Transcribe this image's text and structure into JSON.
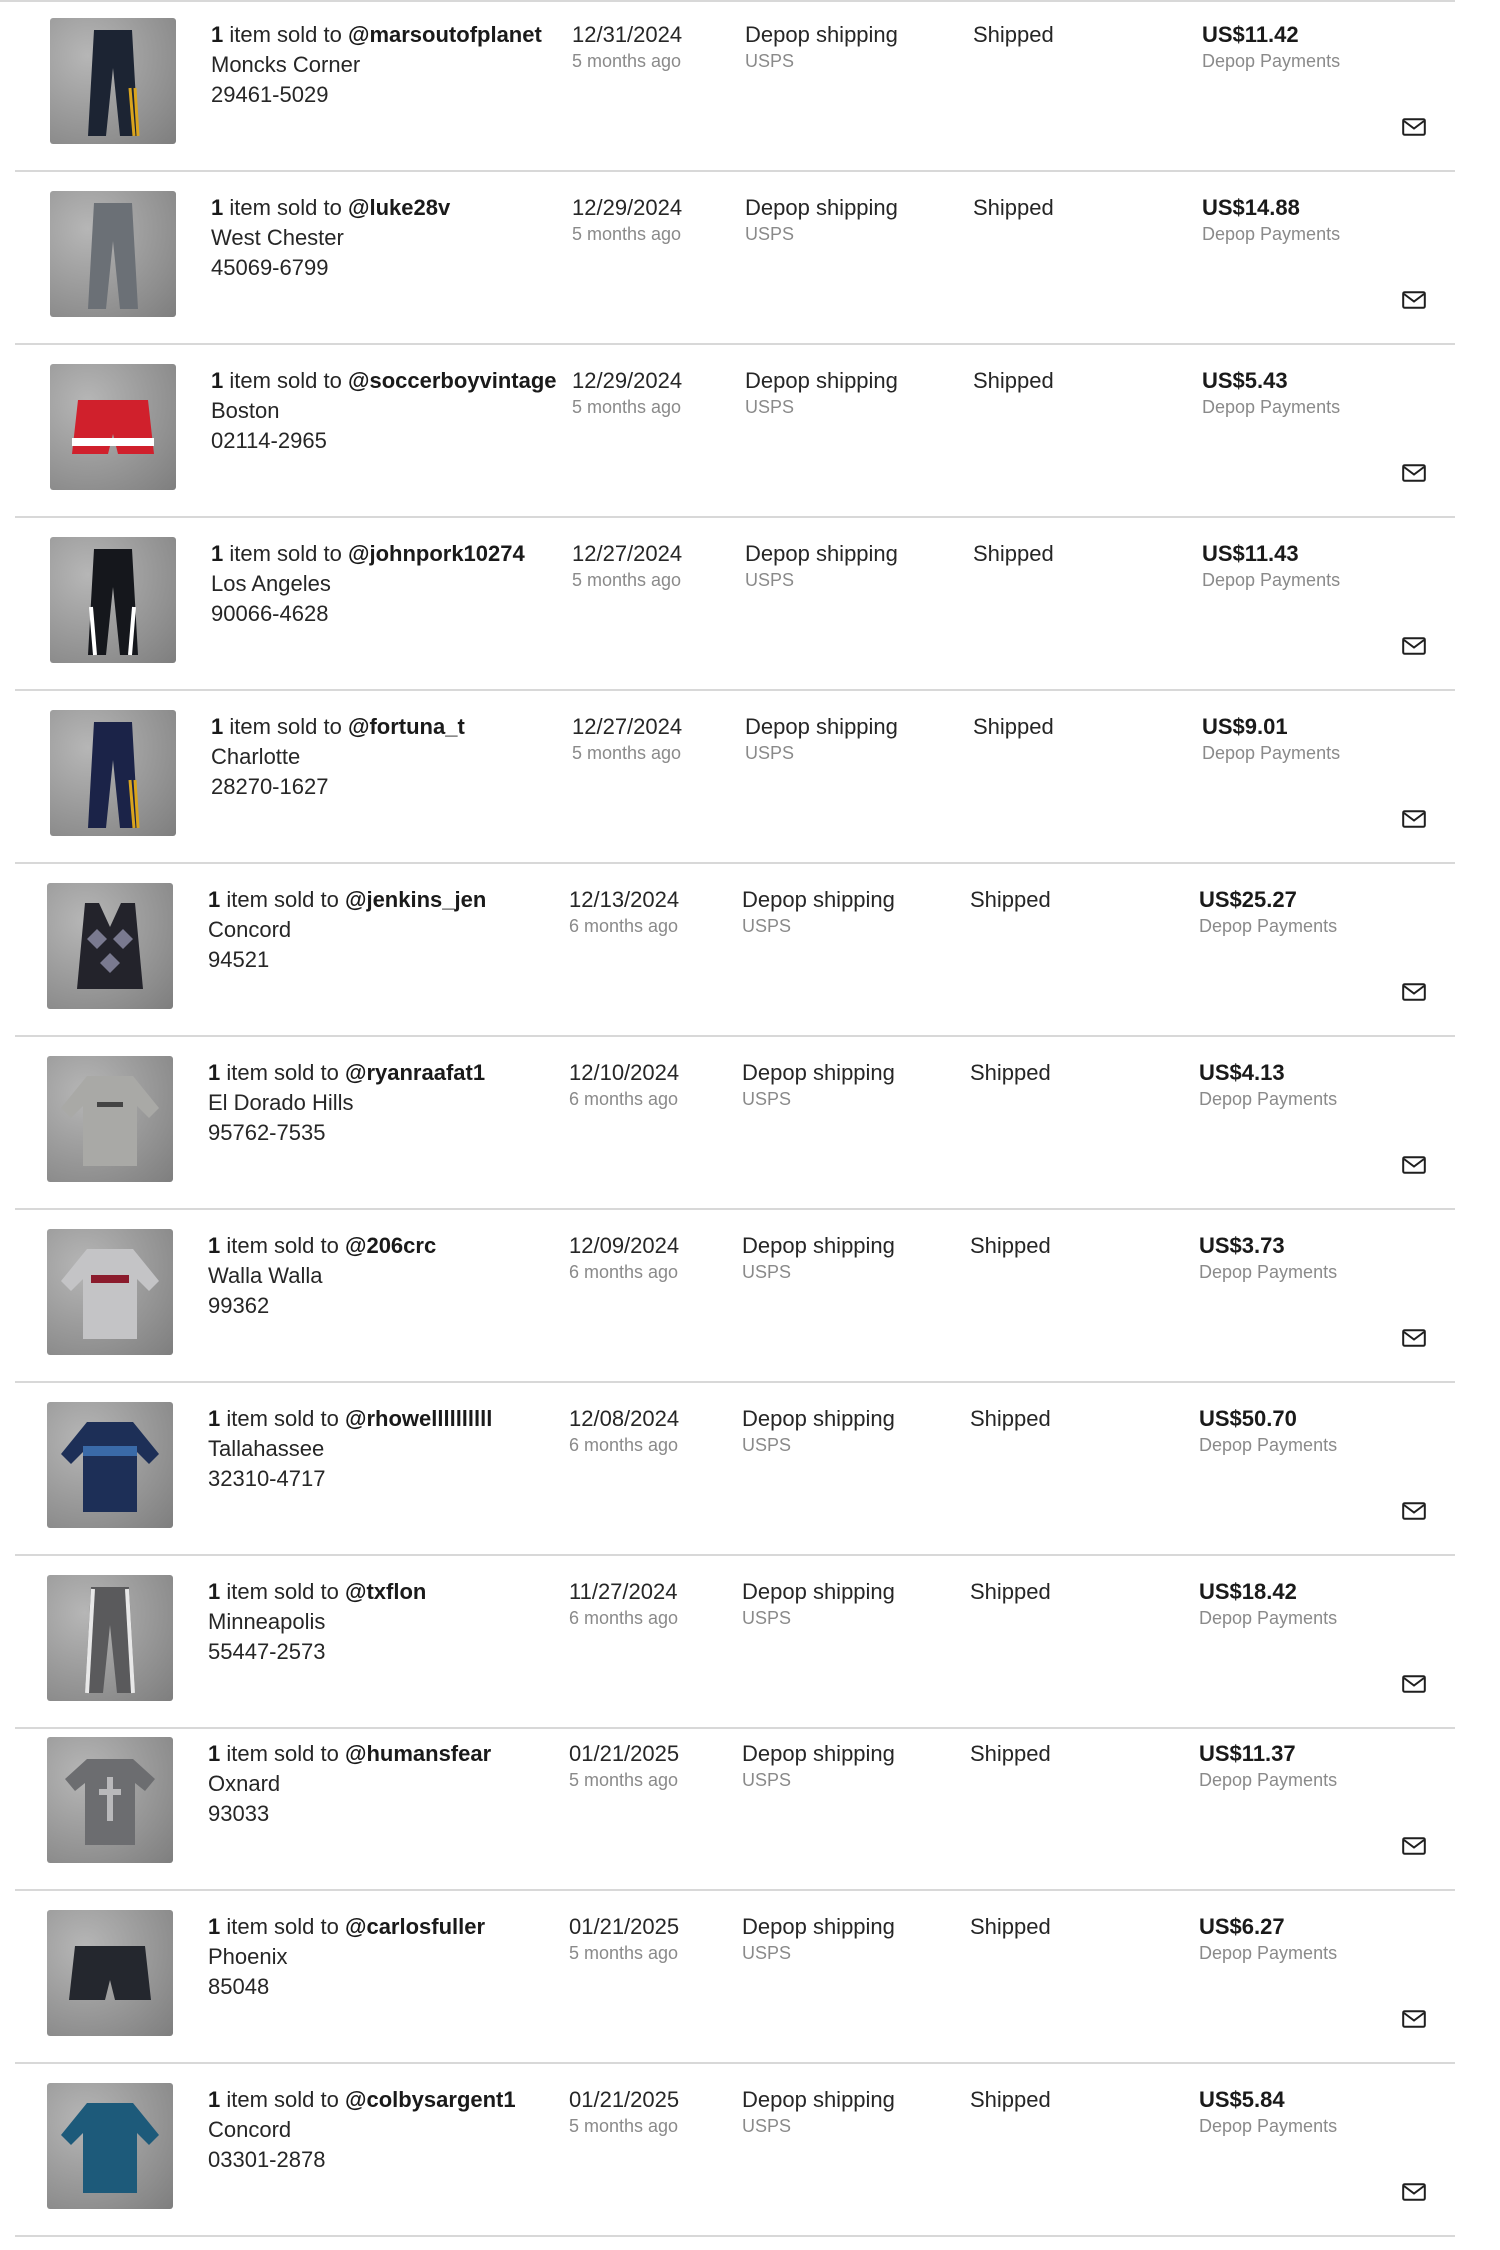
{
  "colors": {
    "text": "#262626",
    "muted": "#8a8a8a",
    "divider": "#d8d8d8"
  },
  "mail_icon": "mail-icon",
  "orders": [
    {
      "count": "1",
      "sold_to": "item sold to",
      "username": "@marsoutofplanet",
      "city": "Moncks Corner",
      "zip": "29461-5029",
      "date": "12/31/2024",
      "ago": "5 months ago",
      "shipping": "Depop shipping",
      "carrier": "USPS",
      "status": "Shipped",
      "price": "US$11.42",
      "payment": "Depop Payments",
      "item": "dark navy track pants",
      "color": "#1c2433"
    },
    {
      "count": "1",
      "sold_to": "item sold to",
      "username": "@luke28v",
      "city": "West Chester",
      "zip": "45069-6799",
      "date": "12/29/2024",
      "ago": "5 months ago",
      "shipping": "Depop shipping",
      "carrier": "USPS",
      "status": "Shipped",
      "price": "US$14.88",
      "payment": "Depop Payments",
      "item": "grey sweatpants",
      "color": "#6b7076"
    },
    {
      "count": "1",
      "sold_to": "item sold to",
      "username": "@soccerboyvintage",
      "city": "Boston",
      "zip": "02114-2965",
      "date": "12/29/2024",
      "ago": "5 months ago",
      "shipping": "Depop shipping",
      "carrier": "USPS",
      "status": "Shipped",
      "price": "US$5.43",
      "payment": "Depop Payments",
      "item": "red shorts",
      "color": "#d0202c"
    },
    {
      "count": "1",
      "sold_to": "item sold to",
      "username": "@johnpork10274",
      "city": "Los Angeles",
      "zip": "90066-4628",
      "date": "12/27/2024",
      "ago": "5 months ago",
      "shipping": "Depop shipping",
      "carrier": "USPS",
      "status": "Shipped",
      "price": "US$11.43",
      "payment": "Depop Payments",
      "item": "black track pants",
      "color": "#15171c"
    },
    {
      "count": "1",
      "sold_to": "item sold to",
      "username": "@fortuna_t",
      "city": "Charlotte",
      "zip": "28270-1627",
      "date": "12/27/2024",
      "ago": "5 months ago",
      "shipping": "Depop shipping",
      "carrier": "USPS",
      "status": "Shipped",
      "price": "US$9.01",
      "payment": "Depop Payments",
      "item": "navy track pants",
      "color": "#1b2348"
    },
    {
      "count": "1",
      "sold_to": "item sold to",
      "username": "@jenkins_jen",
      "city": "Concord",
      "zip": "94521",
      "date": "12/13/2024",
      "ago": "6 months ago",
      "shipping": "Depop shipping",
      "carrier": "USPS",
      "status": "Shipped",
      "price": "US$25.27",
      "payment": "Depop Payments",
      "item": "argyle vest",
      "color": "#23232b"
    },
    {
      "count": "1",
      "sold_to": "item sold to",
      "username": "@ryanraafat1",
      "city": "El Dorado Hills",
      "zip": "95762-7535",
      "date": "12/10/2024",
      "ago": "6 months ago",
      "shipping": "Depop shipping",
      "carrier": "USPS",
      "status": "Shipped",
      "price": "US$4.13",
      "payment": "Depop Payments",
      "item": "grey hoodie",
      "color": "#a9a9a6"
    },
    {
      "count": "1",
      "sold_to": "item sold to",
      "username": "@206crc",
      "city": "Walla Walla",
      "zip": "99362",
      "date": "12/09/2024",
      "ago": "6 months ago",
      "shipping": "Depop shipping",
      "carrier": "USPS",
      "status": "Shipped",
      "price": "US$3.73",
      "payment": "Depop Payments",
      "item": "grey crewneck",
      "color": "#c4c4c6"
    },
    {
      "count": "1",
      "sold_to": "item sold to",
      "username": "@rhowellllllllll",
      "city": "Tallahassee",
      "zip": "32310-4717",
      "date": "12/08/2024",
      "ago": "6 months ago",
      "shipping": "Depop shipping",
      "carrier": "USPS",
      "status": "Shipped",
      "price": "US$50.70",
      "payment": "Depop Payments",
      "item": "blue jacket",
      "color": "#1d2f57"
    },
    {
      "count": "1",
      "sold_to": "item sold to",
      "username": "@txflon",
      "city": "Minneapolis",
      "zip": "55447-2573",
      "date": "11/27/2024",
      "ago": "6 months ago",
      "shipping": "Depop shipping",
      "carrier": "USPS",
      "status": "Shipped",
      "price": "US$18.42",
      "payment": "Depop Payments",
      "item": "grey track pants",
      "color": "#5a5a5c"
    },
    {
      "count": "1",
      "sold_to": "item sold to",
      "username": "@humansfear",
      "city": "Oxnard",
      "zip": "93033",
      "date": "01/21/2025",
      "ago": "5 months ago",
      "shipping": "Depop shipping",
      "carrier": "USPS",
      "status": "Shipped",
      "price": "US$11.37",
      "payment": "Depop Payments",
      "item": "grey t-shirt",
      "color": "#6c6d70"
    },
    {
      "count": "1",
      "sold_to": "item sold to",
      "username": "@carlosfuller",
      "city": "Phoenix",
      "zip": "85048",
      "date": "01/21/2025",
      "ago": "5 months ago",
      "shipping": "Depop shipping",
      "carrier": "USPS",
      "status": "Shipped",
      "price": "US$6.27",
      "payment": "Depop Payments",
      "item": "black shorts",
      "color": "#24272e"
    },
    {
      "count": "1",
      "sold_to": "item sold to",
      "username": "@colbysargent1",
      "city": "Concord",
      "zip": "03301-2878",
      "date": "01/21/2025",
      "ago": "5 months ago",
      "shipping": "Depop shipping",
      "carrier": "USPS",
      "status": "Shipped",
      "price": "US$5.84",
      "payment": "Depop Payments",
      "item": "blue sweatshirt",
      "color": "#1d5a7a"
    }
  ]
}
